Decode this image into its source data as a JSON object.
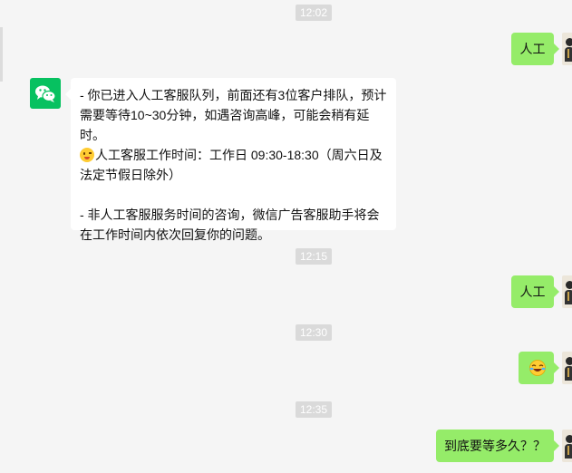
{
  "timestamps": [
    "12:02",
    "12:15",
    "12:30",
    "12:35"
  ],
  "messages": {
    "m1": "人工",
    "bot_line1": "- 你已进入人工客服队列，前面还有3位客户排队，预计需要等待10~30分钟，如遇咨询高峰，可能会稍有延时。",
    "bot_line2": "人工客服工作时间：工作日 09:30-18:30（周六日及法定节假日除外）",
    "bot_line3": "- 非人工客服服务时间的咨询，微信广告客服助手将会在工作时间内依次回复你的问题。",
    "m2": "人工",
    "m4": "到底要等多久？？"
  },
  "icons": {
    "bot_avatar": "wechat-logo-icon",
    "wink_emoji": "wink-face-emoji-icon",
    "sticker": "crying-laughing-emoji-icon"
  },
  "colors": {
    "background": "#f5f5f5",
    "my_bubble": "#95ec69",
    "their_bubble": "#ffffff",
    "timestamp_bg": "#dadada",
    "wechat_green": "#07c160"
  }
}
